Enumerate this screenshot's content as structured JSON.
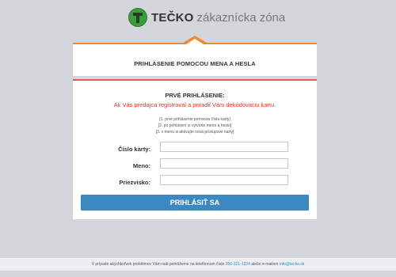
{
  "header": {
    "brand": "TEČKO",
    "subtitle": "zákaznícka zóna",
    "logo_color": "#3e9a3e"
  },
  "login": {
    "title": "PRIHLÁSENIE POMOCOU MENA A HESLA",
    "first_login_heading": "PRVÉ PRIHLÁSENIE:",
    "first_login_message": "Ak Vás predajca registroval a priradil Vám dekódovaciu kartu.",
    "steps": [
      "[1. prvé prihlásenie pomocou čísla karty]",
      "[2. po prihlásení si vytvorte meno a heslo]",
      "[3. v menu si aktivujte nová prístupové karty]"
    ],
    "fields": {
      "card_number": {
        "label": "Číslo karty:",
        "value": ""
      },
      "first_name": {
        "label": "Meno:",
        "value": ""
      },
      "last_name": {
        "label": "Priezvisko:",
        "value": ""
      }
    },
    "submit_label": "PRIHLÁSIŤ SA",
    "accent_color": "#f08a30",
    "alert_color": "#d33a2c",
    "button_color": "#3b89be"
  },
  "footer": {
    "text_before": "V prípade akýchkoľvek problémov Vám radi pomôžeme na telefónnom čísle",
    "phone": "056-321-1234",
    "text_middle": "alebo e-mailom",
    "email": "info@tecko.sk"
  }
}
